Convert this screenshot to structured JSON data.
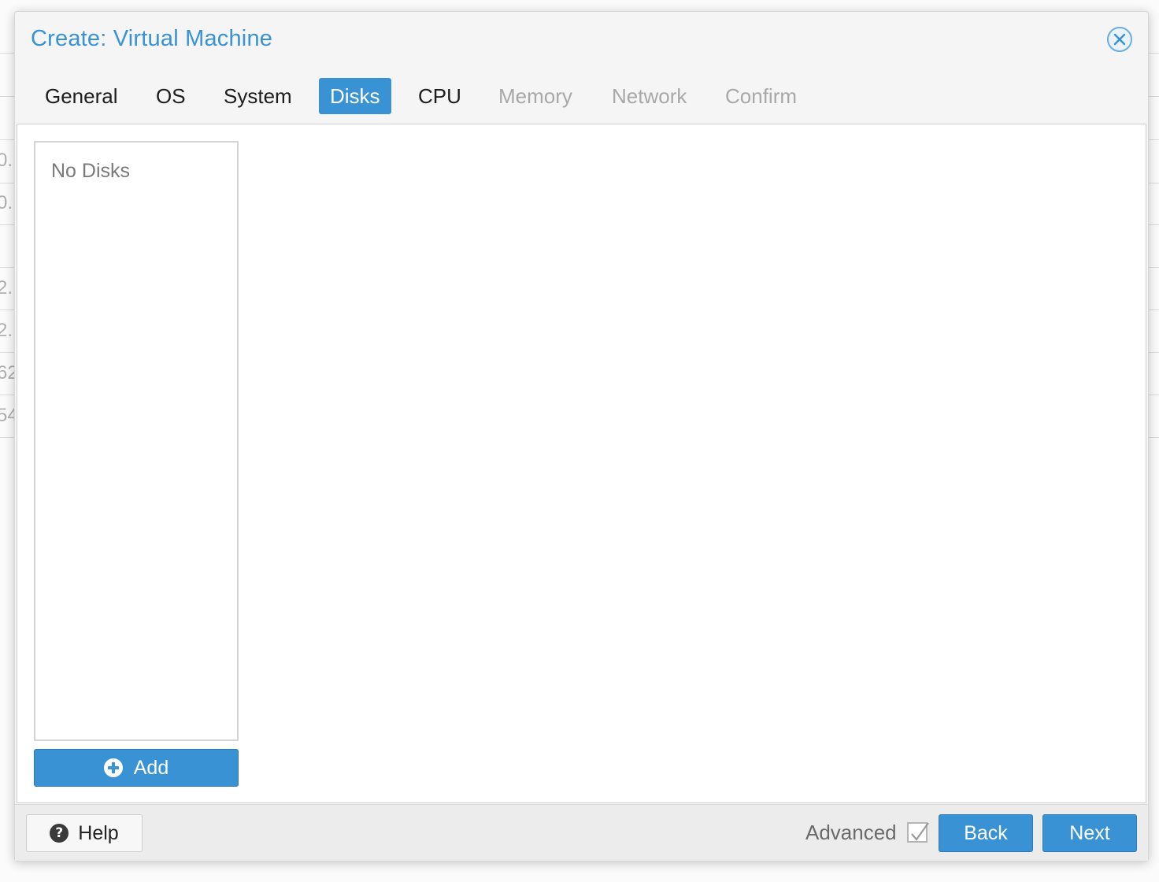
{
  "dialog": {
    "title": "Create: Virtual Machine"
  },
  "background": {
    "fragments": [
      "0.",
      "0.",
      "2.",
      "2.",
      "62",
      "54"
    ]
  },
  "tabs": [
    {
      "label": "General",
      "state": "enabled"
    },
    {
      "label": "OS",
      "state": "enabled"
    },
    {
      "label": "System",
      "state": "enabled"
    },
    {
      "label": "Disks",
      "state": "active"
    },
    {
      "label": "CPU",
      "state": "enabled"
    },
    {
      "label": "Memory",
      "state": "disabled"
    },
    {
      "label": "Network",
      "state": "disabled"
    },
    {
      "label": "Confirm",
      "state": "disabled"
    }
  ],
  "disks": {
    "empty_text": "No Disks",
    "add_label": "Add"
  },
  "footer": {
    "help_label": "Help",
    "advanced_label": "Advanced",
    "advanced_checked": true,
    "back_label": "Back",
    "next_label": "Next"
  },
  "colors": {
    "accent": "#3892d4",
    "disabled_text": "#a8a8a8"
  },
  "icons": {
    "close": "close-icon",
    "add": "plus-circle-icon",
    "help": "question-circle-icon",
    "check": "check-icon"
  }
}
